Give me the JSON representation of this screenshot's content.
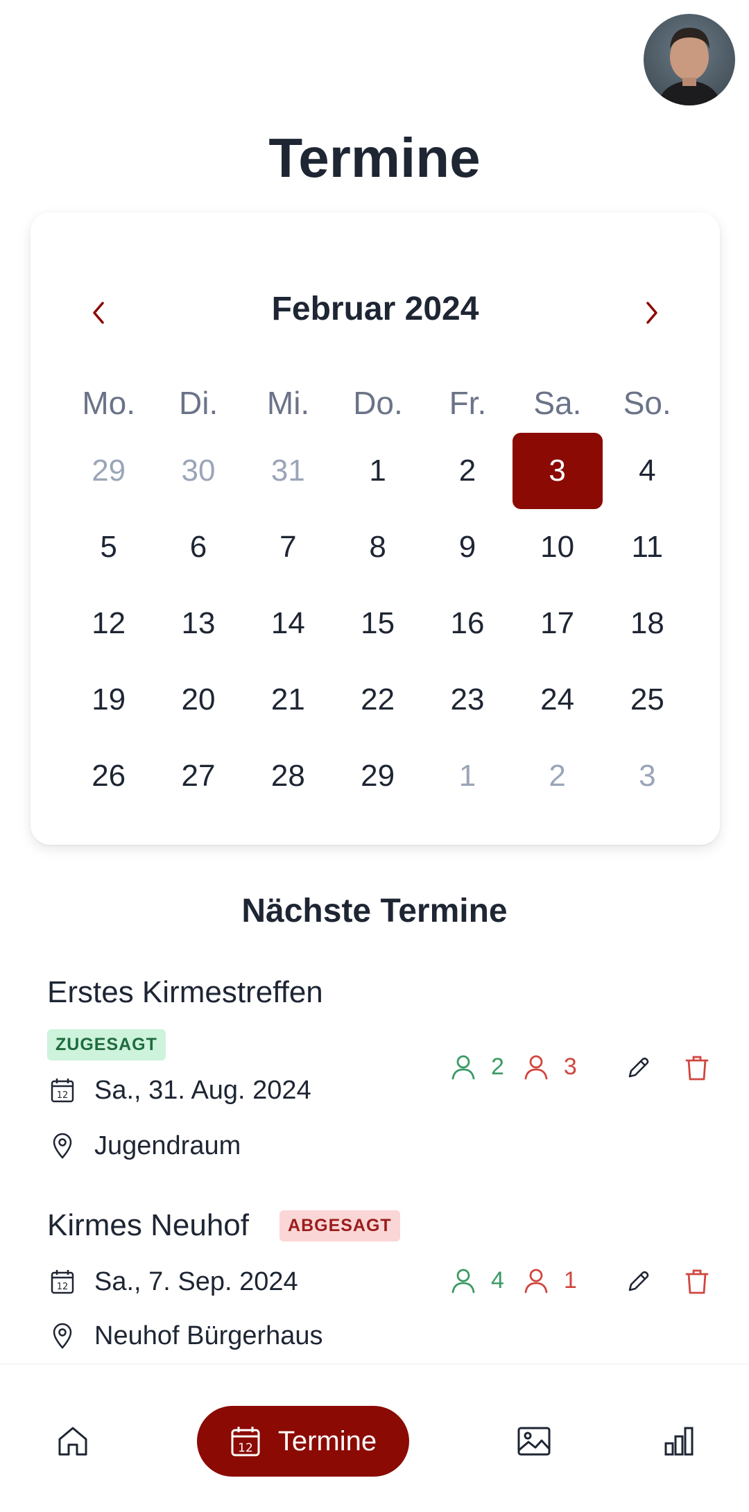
{
  "header": {
    "title": "Termine"
  },
  "calendar": {
    "month_label": "Februar 2024",
    "weekdays": [
      "Mo.",
      "Di.",
      "Mi.",
      "Do.",
      "Fr.",
      "Sa.",
      "So."
    ],
    "days": [
      {
        "n": "29",
        "muted": true
      },
      {
        "n": "30",
        "muted": true
      },
      {
        "n": "31",
        "muted": true
      },
      {
        "n": "1"
      },
      {
        "n": "2"
      },
      {
        "n": "3",
        "selected": true
      },
      {
        "n": "4"
      },
      {
        "n": "5"
      },
      {
        "n": "6"
      },
      {
        "n": "7"
      },
      {
        "n": "8"
      },
      {
        "n": "9"
      },
      {
        "n": "10"
      },
      {
        "n": "11"
      },
      {
        "n": "12"
      },
      {
        "n": "13"
      },
      {
        "n": "14"
      },
      {
        "n": "15"
      },
      {
        "n": "16"
      },
      {
        "n": "17"
      },
      {
        "n": "18"
      },
      {
        "n": "19"
      },
      {
        "n": "20"
      },
      {
        "n": "21"
      },
      {
        "n": "22"
      },
      {
        "n": "23"
      },
      {
        "n": "24"
      },
      {
        "n": "25"
      },
      {
        "n": "26"
      },
      {
        "n": "27"
      },
      {
        "n": "28"
      },
      {
        "n": "29"
      },
      {
        "n": "1",
        "muted": true
      },
      {
        "n": "2",
        "muted": true
      },
      {
        "n": "3",
        "muted": true
      }
    ]
  },
  "section": {
    "title": "Nächste Termine"
  },
  "events": [
    {
      "title": "Erstes Kirmestreffen",
      "status": "ZUGESAGT",
      "date": "Sa., 31. Aug. 2024",
      "location": "Jugendraum",
      "accepted": "2",
      "declined": "3"
    },
    {
      "title": "Kirmes Neuhof",
      "status": "ABGESAGT",
      "date": "Sa., 7. Sep. 2024",
      "location": "Neuhof Bürgerhaus",
      "accepted": "4",
      "declined": "1"
    }
  ],
  "nav": {
    "active_label": "Termine"
  },
  "colors": {
    "accent": "#8b0a03",
    "accepted": "#3a9a64",
    "declined": "#d0463f"
  },
  "icons": [
    "avatar",
    "chevron-left-icon",
    "chevron-right-icon",
    "calendar-icon",
    "location-pin-icon",
    "user-icon",
    "pencil-icon",
    "trash-icon",
    "home-icon",
    "image-icon",
    "bar-chart-icon"
  ]
}
